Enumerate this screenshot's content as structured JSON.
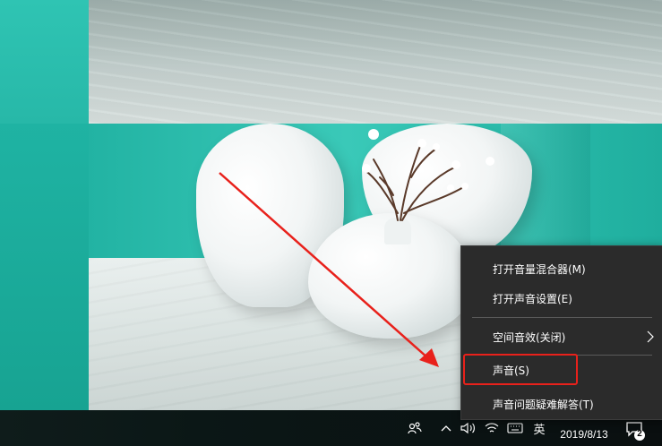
{
  "context_menu": {
    "items": [
      {
        "label": "打开音量混合器(M)"
      },
      {
        "label": "打开声音设置(E)"
      },
      {
        "label": "空间音效(关闭)",
        "has_submenu": true
      },
      {
        "label": "声音(S)",
        "highlighted": true
      },
      {
        "label": "声音问题疑难解答(T)"
      }
    ]
  },
  "taskbar": {
    "ime_label": "英",
    "clock_date": "2019/8/13",
    "notification_count": "2"
  },
  "annotation": {
    "arrow_color": "#e8211b",
    "box_color": "#e8211b"
  }
}
